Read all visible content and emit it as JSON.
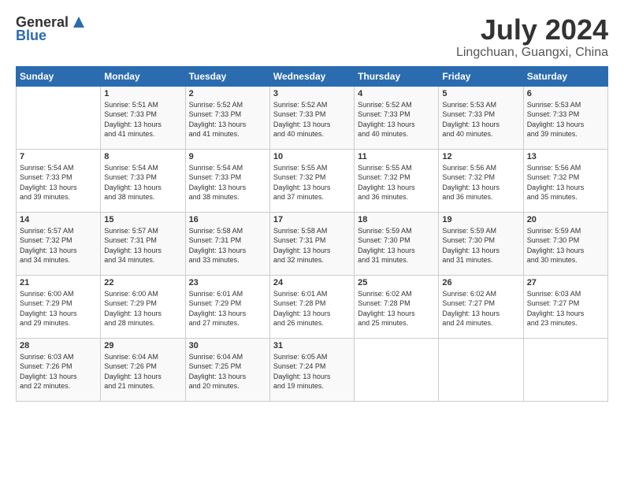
{
  "header": {
    "logo_line1": "General",
    "logo_line2": "Blue",
    "month_year": "July 2024",
    "location": "Lingchuan, Guangxi, China"
  },
  "days_of_week": [
    "Sunday",
    "Monday",
    "Tuesday",
    "Wednesday",
    "Thursday",
    "Friday",
    "Saturday"
  ],
  "weeks": [
    [
      {
        "day": "",
        "data": ""
      },
      {
        "day": "1",
        "data": "Sunrise: 5:51 AM\nSunset: 7:33 PM\nDaylight: 13 hours\nand 41 minutes."
      },
      {
        "day": "2",
        "data": "Sunrise: 5:52 AM\nSunset: 7:33 PM\nDaylight: 13 hours\nand 41 minutes."
      },
      {
        "day": "3",
        "data": "Sunrise: 5:52 AM\nSunset: 7:33 PM\nDaylight: 13 hours\nand 40 minutes."
      },
      {
        "day": "4",
        "data": "Sunrise: 5:52 AM\nSunset: 7:33 PM\nDaylight: 13 hours\nand 40 minutes."
      },
      {
        "day": "5",
        "data": "Sunrise: 5:53 AM\nSunset: 7:33 PM\nDaylight: 13 hours\nand 40 minutes."
      },
      {
        "day": "6",
        "data": "Sunrise: 5:53 AM\nSunset: 7:33 PM\nDaylight: 13 hours\nand 39 minutes."
      }
    ],
    [
      {
        "day": "7",
        "data": "Sunrise: 5:54 AM\nSunset: 7:33 PM\nDaylight: 13 hours\nand 39 minutes."
      },
      {
        "day": "8",
        "data": "Sunrise: 5:54 AM\nSunset: 7:33 PM\nDaylight: 13 hours\nand 38 minutes."
      },
      {
        "day": "9",
        "data": "Sunrise: 5:54 AM\nSunset: 7:33 PM\nDaylight: 13 hours\nand 38 minutes."
      },
      {
        "day": "10",
        "data": "Sunrise: 5:55 AM\nSunset: 7:32 PM\nDaylight: 13 hours\nand 37 minutes."
      },
      {
        "day": "11",
        "data": "Sunrise: 5:55 AM\nSunset: 7:32 PM\nDaylight: 13 hours\nand 36 minutes."
      },
      {
        "day": "12",
        "data": "Sunrise: 5:56 AM\nSunset: 7:32 PM\nDaylight: 13 hours\nand 36 minutes."
      },
      {
        "day": "13",
        "data": "Sunrise: 5:56 AM\nSunset: 7:32 PM\nDaylight: 13 hours\nand 35 minutes."
      }
    ],
    [
      {
        "day": "14",
        "data": "Sunrise: 5:57 AM\nSunset: 7:32 PM\nDaylight: 13 hours\nand 34 minutes."
      },
      {
        "day": "15",
        "data": "Sunrise: 5:57 AM\nSunset: 7:31 PM\nDaylight: 13 hours\nand 34 minutes."
      },
      {
        "day": "16",
        "data": "Sunrise: 5:58 AM\nSunset: 7:31 PM\nDaylight: 13 hours\nand 33 minutes."
      },
      {
        "day": "17",
        "data": "Sunrise: 5:58 AM\nSunset: 7:31 PM\nDaylight: 13 hours\nand 32 minutes."
      },
      {
        "day": "18",
        "data": "Sunrise: 5:59 AM\nSunset: 7:30 PM\nDaylight: 13 hours\nand 31 minutes."
      },
      {
        "day": "19",
        "data": "Sunrise: 5:59 AM\nSunset: 7:30 PM\nDaylight: 13 hours\nand 31 minutes."
      },
      {
        "day": "20",
        "data": "Sunrise: 5:59 AM\nSunset: 7:30 PM\nDaylight: 13 hours\nand 30 minutes."
      }
    ],
    [
      {
        "day": "21",
        "data": "Sunrise: 6:00 AM\nSunset: 7:29 PM\nDaylight: 13 hours\nand 29 minutes."
      },
      {
        "day": "22",
        "data": "Sunrise: 6:00 AM\nSunset: 7:29 PM\nDaylight: 13 hours\nand 28 minutes."
      },
      {
        "day": "23",
        "data": "Sunrise: 6:01 AM\nSunset: 7:29 PM\nDaylight: 13 hours\nand 27 minutes."
      },
      {
        "day": "24",
        "data": "Sunrise: 6:01 AM\nSunset: 7:28 PM\nDaylight: 13 hours\nand 26 minutes."
      },
      {
        "day": "25",
        "data": "Sunrise: 6:02 AM\nSunset: 7:28 PM\nDaylight: 13 hours\nand 25 minutes."
      },
      {
        "day": "26",
        "data": "Sunrise: 6:02 AM\nSunset: 7:27 PM\nDaylight: 13 hours\nand 24 minutes."
      },
      {
        "day": "27",
        "data": "Sunrise: 6:03 AM\nSunset: 7:27 PM\nDaylight: 13 hours\nand 23 minutes."
      }
    ],
    [
      {
        "day": "28",
        "data": "Sunrise: 6:03 AM\nSunset: 7:26 PM\nDaylight: 13 hours\nand 22 minutes."
      },
      {
        "day": "29",
        "data": "Sunrise: 6:04 AM\nSunset: 7:26 PM\nDaylight: 13 hours\nand 21 minutes."
      },
      {
        "day": "30",
        "data": "Sunrise: 6:04 AM\nSunset: 7:25 PM\nDaylight: 13 hours\nand 20 minutes."
      },
      {
        "day": "31",
        "data": "Sunrise: 6:05 AM\nSunset: 7:24 PM\nDaylight: 13 hours\nand 19 minutes."
      },
      {
        "day": "",
        "data": ""
      },
      {
        "day": "",
        "data": ""
      },
      {
        "day": "",
        "data": ""
      }
    ]
  ]
}
